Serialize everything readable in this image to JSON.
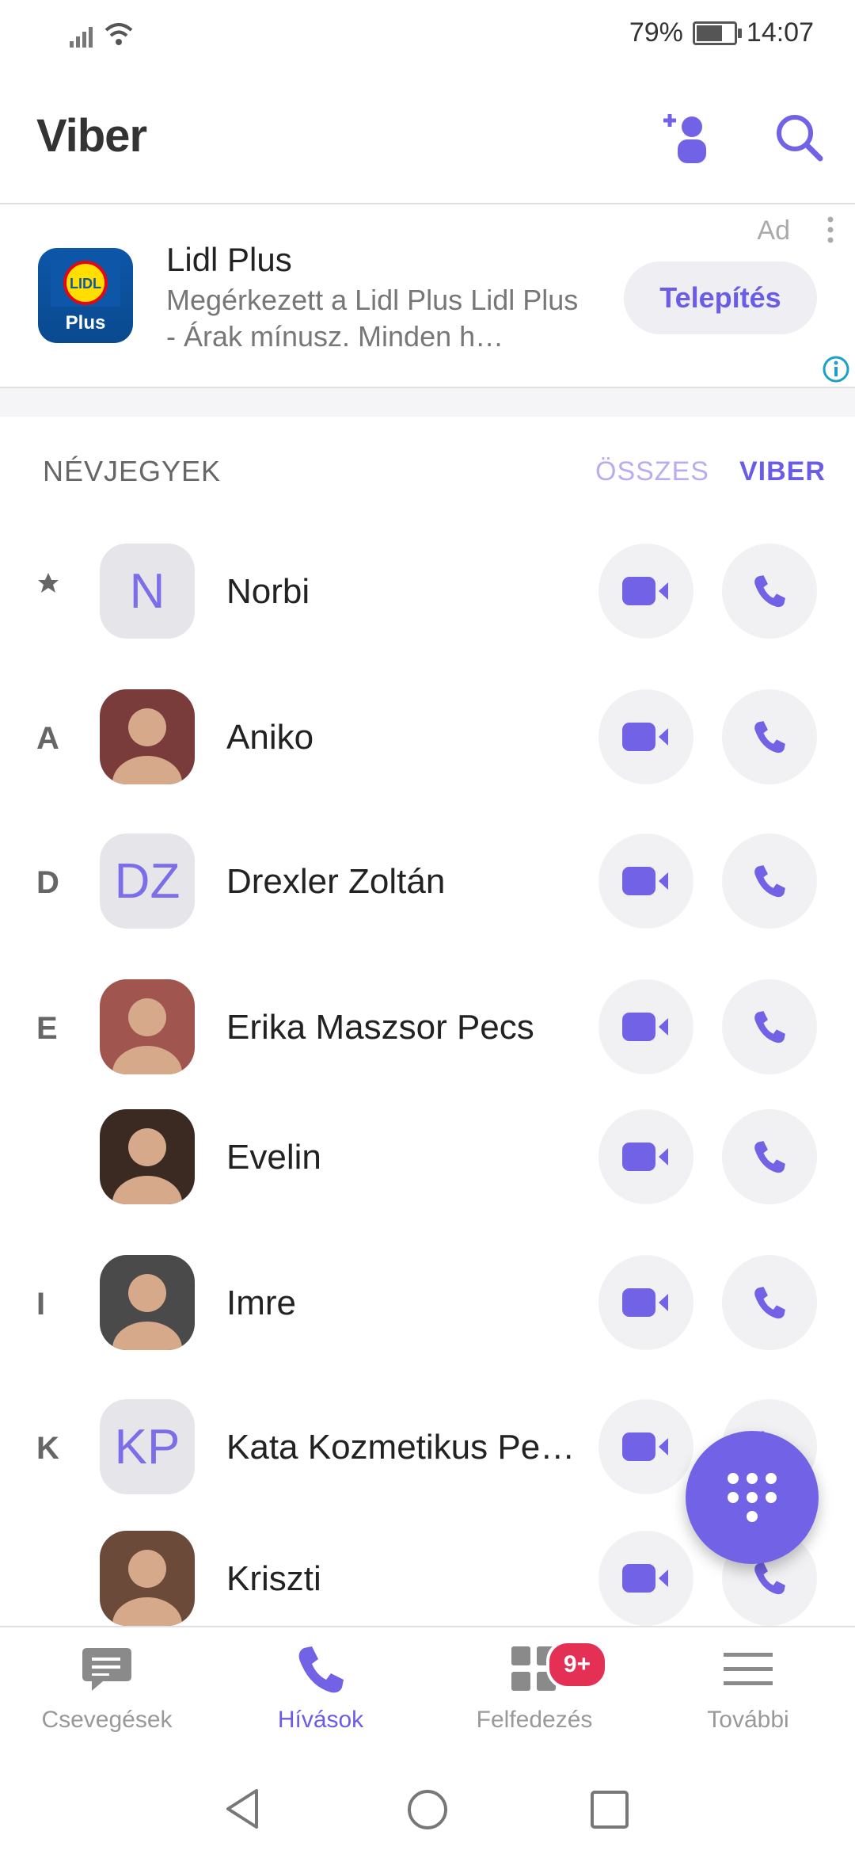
{
  "status_bar": {
    "battery_percent": "79%",
    "time": "14:07",
    "battery_level": 0.79
  },
  "header": {
    "app_title": "Viber"
  },
  "ad": {
    "label": "Ad",
    "title": "Lidl Plus",
    "description": "Megérkezett a Lidl Plus Lidl Plus - Árak mínusz. Minden h…",
    "cta": "Telepítés",
    "logo_top": "LIDL",
    "logo_bottom": "Plus"
  },
  "contacts_section": {
    "title": "NÉVJEGYEK",
    "filter_all": "ÖSSZES",
    "filter_viber": "VIBER"
  },
  "contacts": [
    {
      "letter": "",
      "favorite": true,
      "initials": "N",
      "name": "Norbi",
      "photo": false
    },
    {
      "letter": "A",
      "initials": "",
      "name": "Aniko",
      "photo": true,
      "photo_color": "#7a3b3b"
    },
    {
      "letter": "D",
      "initials": "DZ",
      "name": "Drexler Zoltán",
      "photo": false
    },
    {
      "letter": "E",
      "initials": "",
      "name": "Erika Maszsor Pecs",
      "photo": true,
      "photo_color": "#a0554f"
    },
    {
      "letter": "",
      "initials": "",
      "name": "Evelin",
      "photo": true,
      "photo_color": "#3a2a22"
    },
    {
      "letter": "I",
      "initials": "",
      "name": "Imre",
      "photo": true,
      "photo_color": "#4a4a4a"
    },
    {
      "letter": "K",
      "initials": "KP",
      "name": "Kata Kozmetikus Pe…",
      "photo": false
    },
    {
      "letter": "",
      "initials": "",
      "name": "Kriszti",
      "photo": true,
      "photo_color": "#6b4a3a"
    }
  ],
  "bottom_nav": [
    {
      "label": "Csevegések",
      "icon": "chat-bubble-icon"
    },
    {
      "label": "Hívások",
      "icon": "phone-icon",
      "active": true
    },
    {
      "label": "Felfedezés",
      "icon": "explore-grid-icon",
      "badge": "9+"
    },
    {
      "label": "További",
      "icon": "menu-icon"
    }
  ],
  "colors": {
    "accent": "#7262e6",
    "badge": "#e53055"
  }
}
